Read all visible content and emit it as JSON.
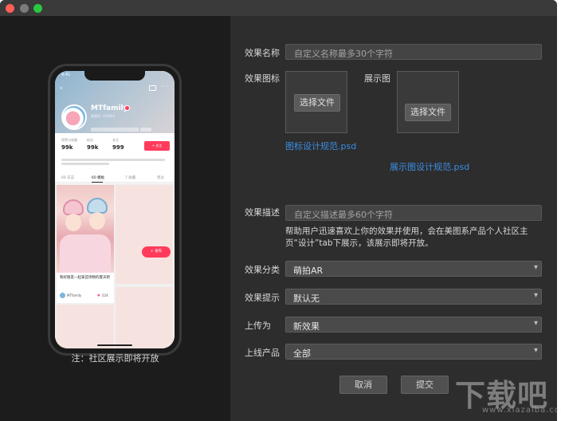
{
  "phone": {
    "status_time": "9:41",
    "username": "MTfamily",
    "user_id": "美图ID: 343844",
    "stats": [
      {
        "label": "获赞与收藏",
        "value": "99k"
      },
      {
        "label": "粉丝",
        "value": "99k"
      },
      {
        "label": "关注",
        "value": "999"
      }
    ],
    "follow_label": "+ 关注",
    "tabs": [
      "68 日志",
      "60 模板",
      "7 收藏",
      "赞过"
    ],
    "card": {
      "caption": "和好朋友一起拿首饰物的夏天吧",
      "author": "MTfamily",
      "likes": "224"
    },
    "publish_label": "+ 发布"
  },
  "left_note": "注：社区展示即将开放",
  "form": {
    "name_label": "效果名称",
    "name_placeholder": "自定义名称最多30个字符",
    "icon_label": "效果图标",
    "preview_label": "展示图",
    "choose_file_label": "选择文件",
    "icon_link": "图标设计规范.psd",
    "preview_link": "展示图设计规范.psd",
    "desc_label": "效果描述",
    "desc_placeholder": "自定义描述最多60个字符",
    "desc_help_1": "帮助用户迅速喜欢上你的效果并使用，会在美图系产品个人社区主",
    "desc_help_2": "页“设计”tab下展示，该展示即将开放。",
    "category_label": "效果分类",
    "category_value": "萌拍AR",
    "hint_label": "效果提示",
    "hint_value": "默认无",
    "upload_as_label": "上传为",
    "upload_as_value": "新效果",
    "product_label": "上线产品",
    "product_value": "全部",
    "cancel_label": "取消",
    "submit_label": "提交"
  },
  "watermark": {
    "text": "下载吧",
    "sub": "www.xiazaiba.com"
  },
  "colors": {
    "accent_pink": "#ff3b5c",
    "link_blue": "#3a8ee6",
    "panel_dark": "#2d2d2d"
  }
}
